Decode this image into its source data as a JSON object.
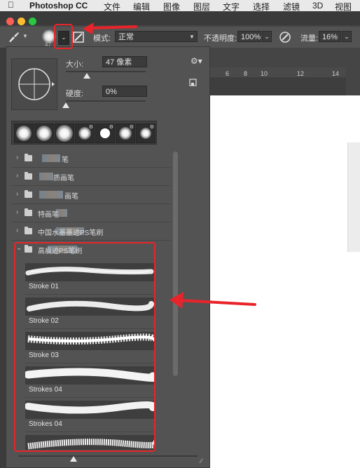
{
  "menubar": {
    "apple_icon": "apple-icon",
    "items": [
      "Photoshop CC",
      "文件",
      "编辑",
      "图像",
      "图层",
      "文字",
      "选择",
      "滤镜",
      "3D",
      "视图"
    ]
  },
  "options_bar": {
    "brush_size_small": "47",
    "mode_label": "模式:",
    "mode_value": "正常",
    "opacity_label": "不透明度:",
    "opacity_value": "100%",
    "flow_label": "流量:",
    "flow_value": "16%"
  },
  "ruler": {
    "ticks": [
      "6",
      "8",
      "10",
      "12",
      "14"
    ]
  },
  "brush_panel": {
    "size_label": "大小:",
    "size_value": "47 像素",
    "hardness_label": "硬度:",
    "hardness_value": "0%",
    "size_slider_fraction": 0.26,
    "hardness_slider_fraction": 0.0,
    "groups": [
      {
        "name": "笔",
        "expanded": false
      },
      {
        "name": "质画笔",
        "expanded": false
      },
      {
        "name": "画笔",
        "expanded": false
      },
      {
        "name": "特画笔",
        "expanded": false
      },
      {
        "name": "中国水墨墨迹PS笔刷",
        "expanded": false
      },
      {
        "name": "高痕迹PS笔刷",
        "expanded": true
      }
    ],
    "strokes": [
      "Stroke 01",
      "Stroke 02",
      "Stroke 03",
      "Strokes 04",
      "Strokes 04"
    ]
  },
  "colors": {
    "annotation_red": "#e8242a",
    "panel_bg": "#535353",
    "menubar_bg": "#e9e9e9"
  }
}
